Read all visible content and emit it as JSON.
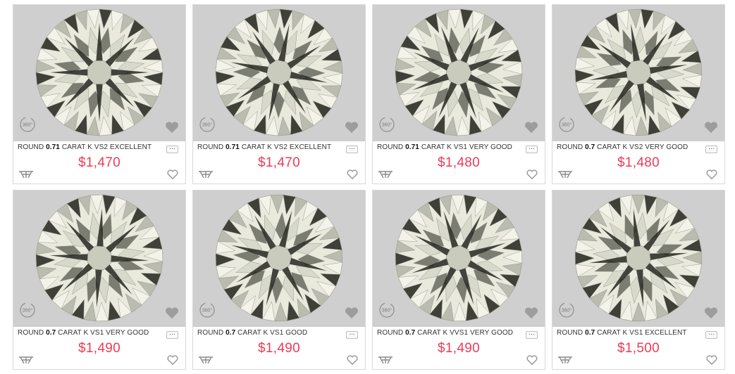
{
  "listings": [
    {
      "shape": "ROUND",
      "carat": "0.71",
      "rest": "CARAT K VS2  EXCELLENT",
      "price": "$1,470"
    },
    {
      "shape": "ROUND",
      "carat": "0.71",
      "rest": "CARAT K VS2  EXCELLENT",
      "price": "$1,470"
    },
    {
      "shape": "ROUND",
      "carat": "0.71",
      "rest": "CARAT K VS1  VERY GOOD",
      "price": "$1,480"
    },
    {
      "shape": "ROUND",
      "carat": "0.7",
      "rest": "CARAT K VS2  VERY GOOD",
      "price": "$1,480"
    },
    {
      "shape": "ROUND",
      "carat": "0.7",
      "rest": "CARAT K VS1  VERY GOOD",
      "price": "$1,490"
    },
    {
      "shape": "ROUND",
      "carat": "0.7",
      "rest": "CARAT K VS1  GOOD",
      "price": "$1,490"
    },
    {
      "shape": "ROUND",
      "carat": "0.7",
      "rest": "CARAT K VVS1  VERY GOOD",
      "price": "$1,490"
    },
    {
      "shape": "ROUND",
      "carat": "0.7",
      "rest": "CARAT K VS1  EXCELLENT",
      "price": "$1,500"
    }
  ],
  "labels": {
    "rotate_360": "360°",
    "more_glyph": "..."
  },
  "icons": {
    "rotate": "360-rotate-icon",
    "wishlist": "heart-icon",
    "more": "more-options-icon",
    "brand": "brand-logo-icon"
  },
  "colors": {
    "price": "#ee3a55",
    "photo_bg": "#cfcfcf",
    "border": "#d9d9d9"
  }
}
